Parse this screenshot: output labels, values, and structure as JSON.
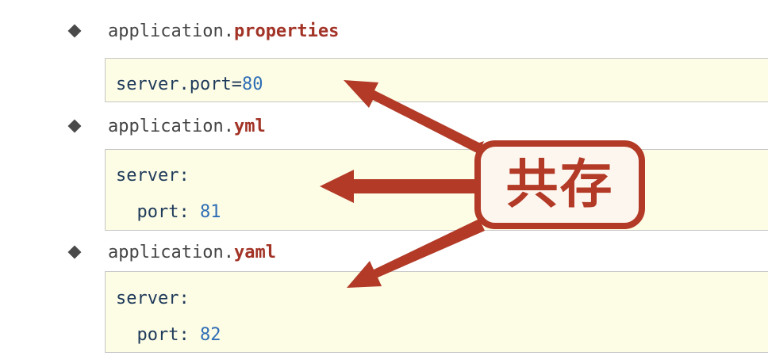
{
  "sections": [
    {
      "prefix": "application.",
      "ext": "properties",
      "lines": [
        {
          "key": "server.port=",
          "value": "80"
        }
      ]
    },
    {
      "prefix": "application.",
      "ext": "yml",
      "lines": [
        {
          "key": "server:",
          "value": ""
        },
        {
          "key": "  port: ",
          "value": "81"
        }
      ]
    },
    {
      "prefix": "application.",
      "ext": "yaml",
      "lines": [
        {
          "key": "server:",
          "value": ""
        },
        {
          "key": "  port: ",
          "value": "82"
        }
      ]
    }
  ],
  "callout": {
    "label": "共存"
  },
  "colors": {
    "accent": "#b23a27",
    "extension": "#a23326",
    "code_bg": "#fdfce5",
    "code_key": "#1e3a5a",
    "code_number": "#2e6db5"
  }
}
